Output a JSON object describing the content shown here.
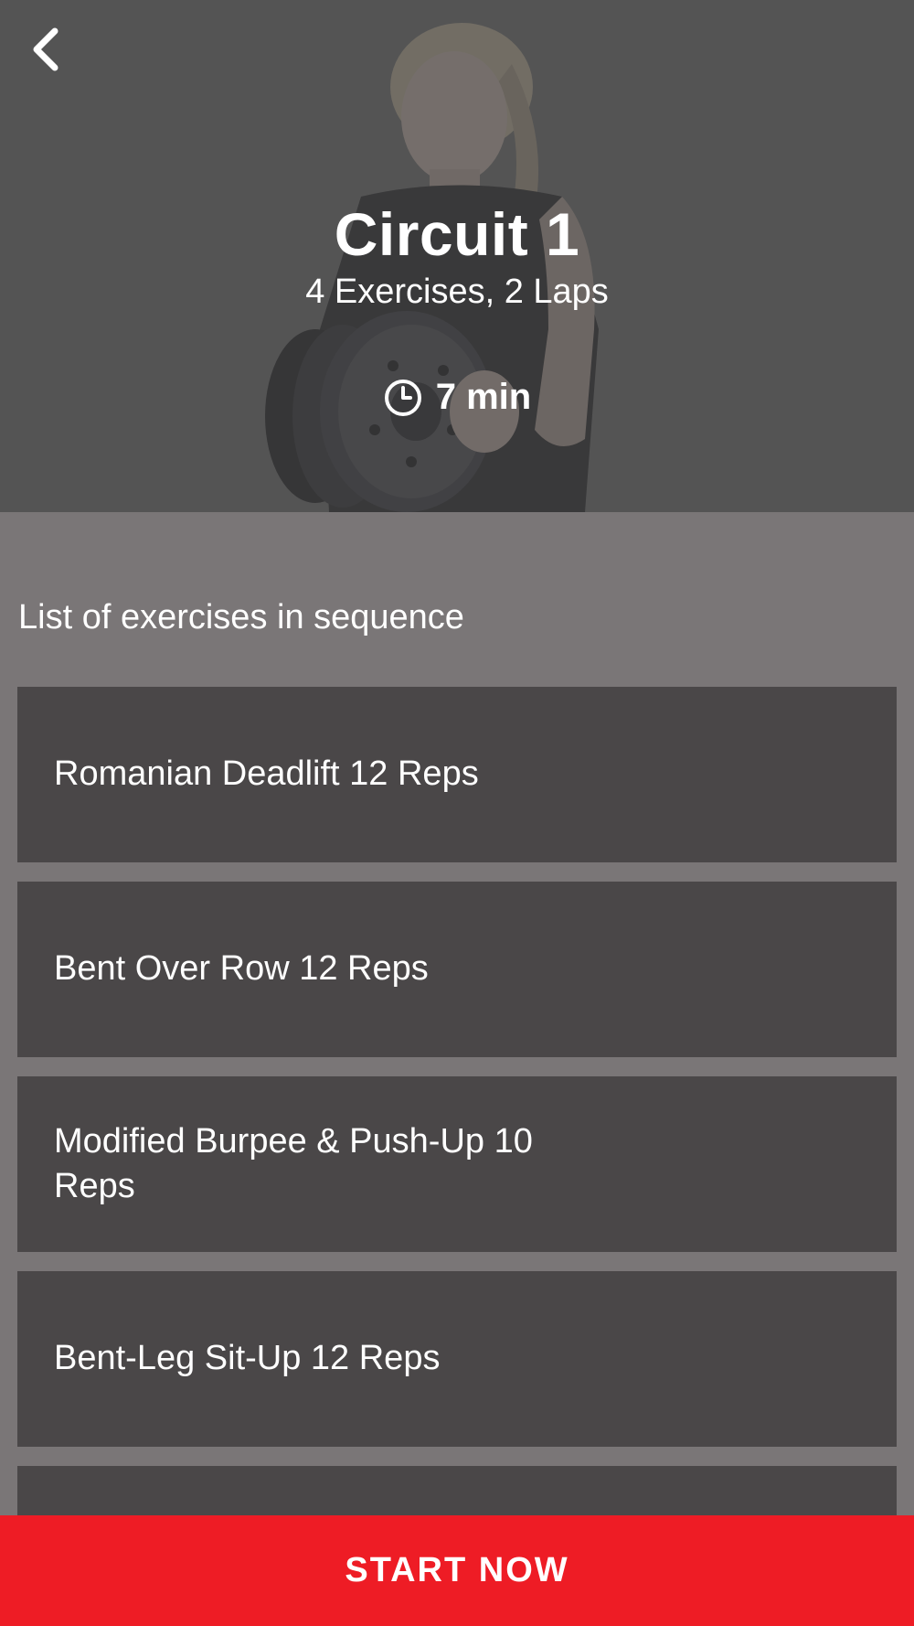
{
  "header": {
    "back_icon": "chevron-left-icon",
    "title": "Circuit 1",
    "subtitle": "4 Exercises, 2 Laps",
    "duration_icon": "clock-icon",
    "duration": "7 min"
  },
  "main": {
    "section_label": "List of exercises in sequence",
    "exercises": [
      {
        "label": "Romanian Deadlift 12 Reps"
      },
      {
        "label": "Bent Over Row 12 Reps"
      },
      {
        "label": "Modified Burpee & Push-Up 10 Reps"
      },
      {
        "label": "Bent-Leg Sit-Up 12 Reps"
      },
      {
        "label": ""
      }
    ]
  },
  "footer": {
    "start_label": "START NOW"
  },
  "colors": {
    "hero_bg": "#5a5a5a",
    "page_bg": "#7a7677",
    "card_bg": "#4a4748",
    "accent": "#ee1c25",
    "text": "#ffffff"
  }
}
